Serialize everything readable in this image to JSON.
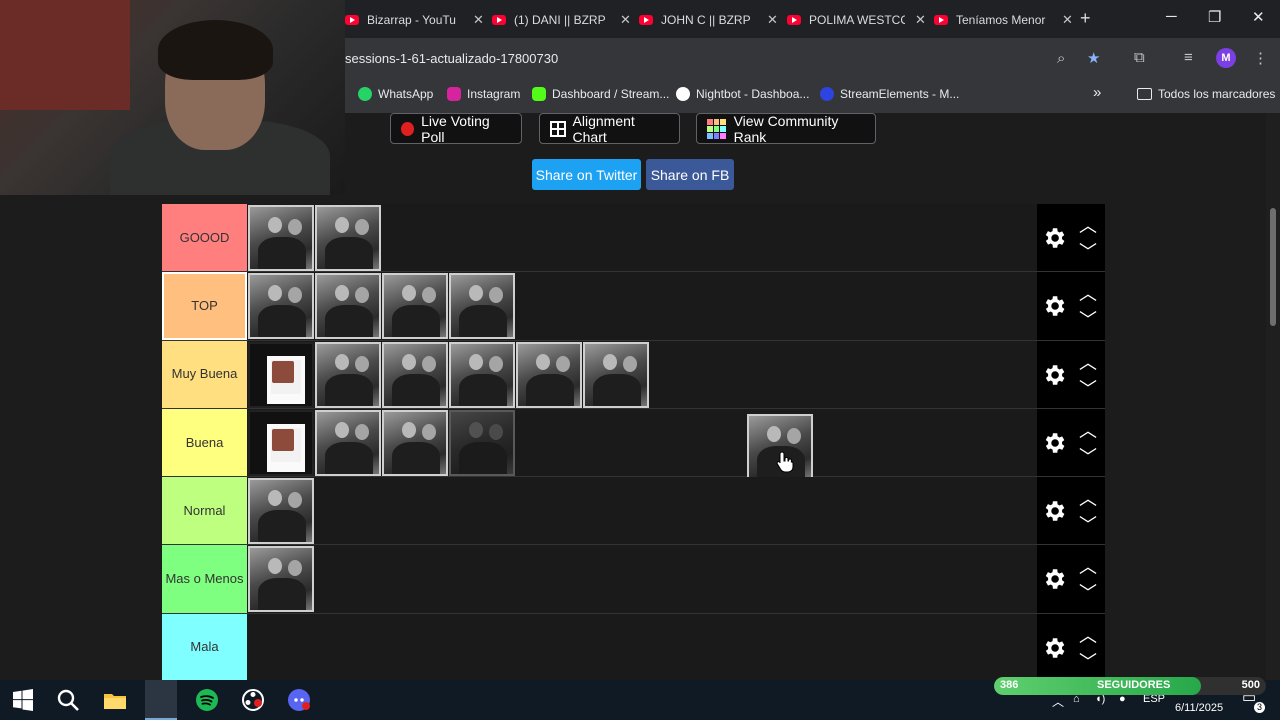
{
  "browser": {
    "tabs": [
      {
        "title": "Bizarrap - YouTu"
      },
      {
        "title": "(1) DANI || BZRP"
      },
      {
        "title": "JOHN C || BZRP"
      },
      {
        "title": "POLIMA WESTCO"
      },
      {
        "title": "Teníamos Menor"
      }
    ],
    "new_tab": "+",
    "url": "sessions-1-61-actualizado-17800730",
    "profile_initial": "M",
    "bookmarks": [
      {
        "label": "WhatsApp",
        "color": "#25d366"
      },
      {
        "label": "Instagram",
        "color": "#d6249f"
      },
      {
        "label": "Dashboard / Stream...",
        "color": "#53fc18"
      },
      {
        "label": "Nightbot - Dashboa...",
        "color": "#ffffff"
      },
      {
        "label": "StreamElements - M...",
        "color": "#2d44e0"
      }
    ],
    "bookmarks_more": "»",
    "all_bookmarks": "Todos los marcadores"
  },
  "page": {
    "buttons": {
      "live_voting": "Live Voting Poll",
      "alignment": "Alignment Chart",
      "community": "View Community Rank",
      "twitter": "Share on Twitter",
      "fb": "Share on FB"
    },
    "colors": {
      "twitter": "#1da1f2",
      "fb": "#3b5998"
    },
    "tiers": [
      {
        "label": "GOOOD",
        "color": "#ff7f7f"
      },
      {
        "label": "TOP",
        "color": "#ffbf7f"
      },
      {
        "label": "Muy Buena",
        "color": "#ffdf7f"
      },
      {
        "label": "Buena",
        "color": "#ffff7f"
      },
      {
        "label": "Normal",
        "color": "#bfff7f"
      },
      {
        "label": "Mas o Menos",
        "color": "#7fff7f"
      },
      {
        "label": "Mala",
        "color": "#7fffff"
      }
    ]
  },
  "taskbar": {
    "lang": "ESP",
    "date": "6/11/2025",
    "notifications": "3",
    "followers": {
      "label": "SEGUIDORES",
      "current": "386",
      "goal": "500",
      "progress": 0.76
    }
  }
}
